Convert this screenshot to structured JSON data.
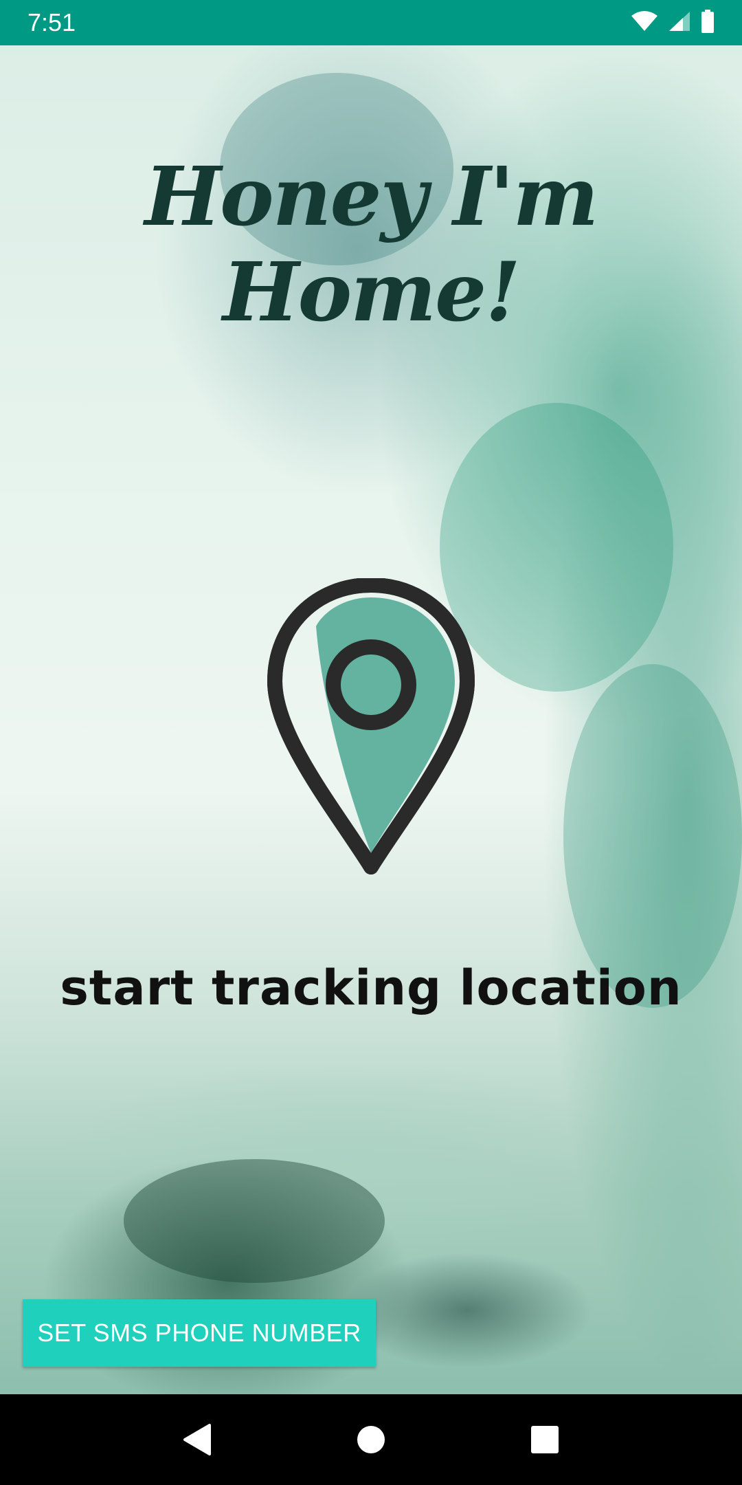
{
  "status_bar": {
    "time": "7:51",
    "icons": [
      "wifi-icon",
      "signal-icon",
      "battery-icon"
    ]
  },
  "app": {
    "title": "Honey I'm Home!",
    "tracking_label": "start tracking location",
    "sms_button_label": "SET SMS PHONE NUMBER"
  },
  "colors": {
    "status_bar": "#009A84",
    "accent_button": "#1FD1BC",
    "pin_fill": "#63B3A0",
    "pin_stroke": "#2A2A2A",
    "title": "#143A33"
  },
  "nav_bar": {
    "icons": [
      "back-icon",
      "home-icon",
      "recents-icon"
    ]
  }
}
